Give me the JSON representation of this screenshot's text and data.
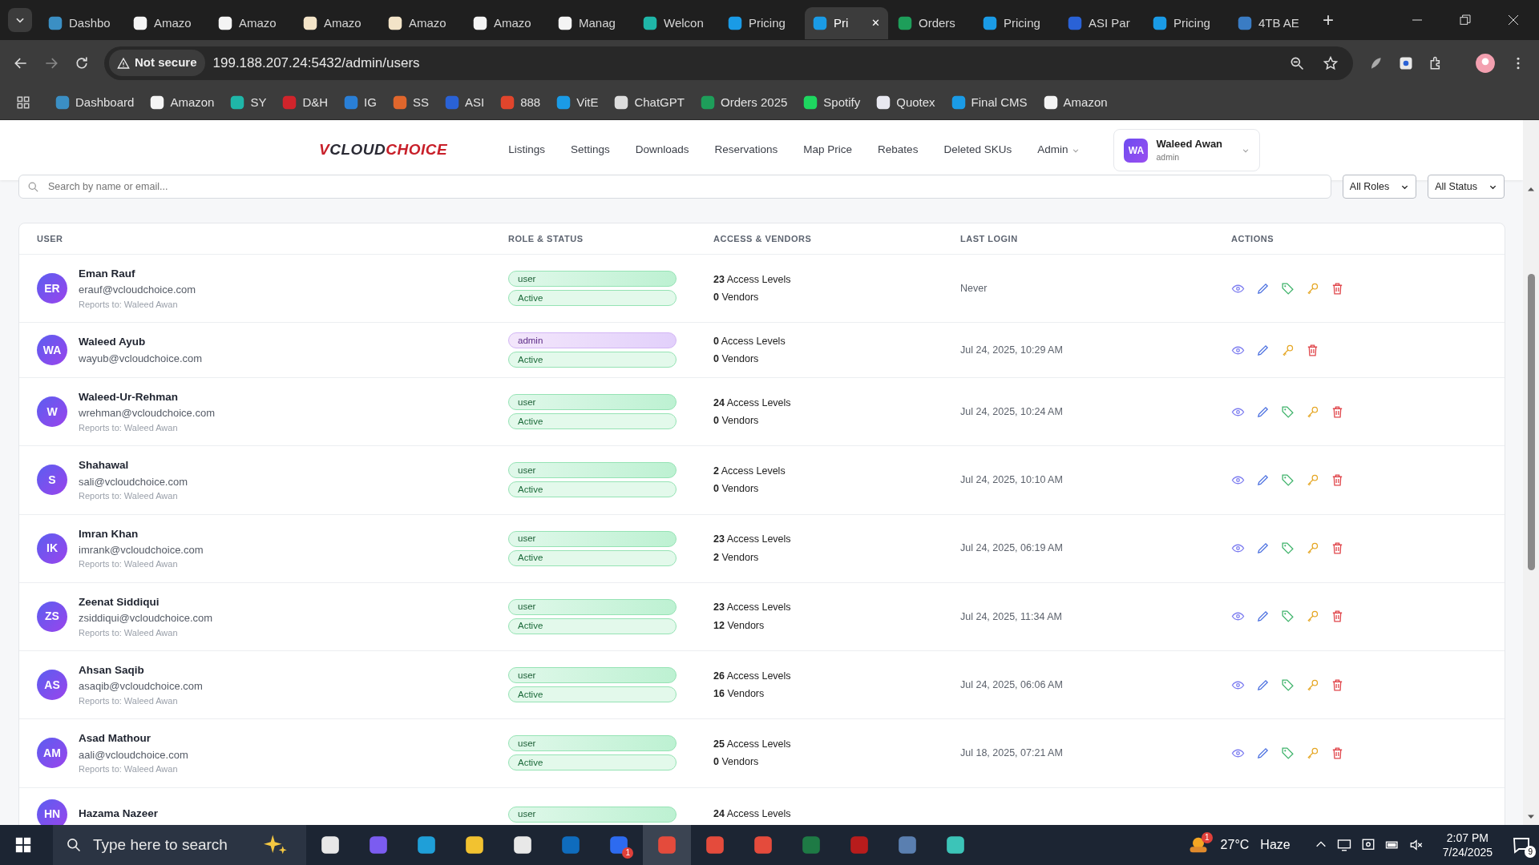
{
  "browser": {
    "tabs": [
      {
        "title": "Dashbo",
        "color": "#3b8fc4",
        "selected": false
      },
      {
        "title": "Amazo",
        "color": "#f4f4f4",
        "selected": false
      },
      {
        "title": "Amazo",
        "color": "#f4f4f4",
        "selected": false
      },
      {
        "title": "Amazo",
        "color": "#f3e4c8",
        "selected": false
      },
      {
        "title": "Amazo",
        "color": "#f3e4c8",
        "selected": false
      },
      {
        "title": "Amazo",
        "color": "#f4f4f4",
        "selected": false
      },
      {
        "title": "Manag",
        "color": "#f4f4f4",
        "selected": false
      },
      {
        "title": "Welcon",
        "color": "#1fb6a8",
        "selected": false
      },
      {
        "title": "Pricing",
        "color": "#1a9be6",
        "selected": false
      },
      {
        "title": "Pri",
        "color": "#1a9be6",
        "selected": true
      },
      {
        "title": "Orders",
        "color": "#1e9e5a",
        "selected": false
      },
      {
        "title": "Pricing",
        "color": "#1a9be6",
        "selected": false
      },
      {
        "title": "ASI Par",
        "color": "#2a62d6",
        "selected": false
      },
      {
        "title": "Pricing",
        "color": "#1a9be6",
        "selected": false
      },
      {
        "title": "4TB AE",
        "color": "#3a7cc4",
        "selected": false
      }
    ],
    "close_glyph": "✕",
    "new_tab_glyph": "+",
    "security_label": "Not secure",
    "url": "199.188.207.24:5432/admin/users",
    "bookmarks": [
      {
        "label": "Dashboard",
        "color": "#3b8fc4"
      },
      {
        "label": "Amazon",
        "color": "#f4f4f4"
      },
      {
        "label": "SY",
        "color": "#1fb6a8"
      },
      {
        "label": "D&H",
        "color": "#d0242b"
      },
      {
        "label": "IG",
        "color": "#2a7fd6"
      },
      {
        "label": "SS",
        "color": "#e0662c"
      },
      {
        "label": "ASI",
        "color": "#2a62d6"
      },
      {
        "label": "888",
        "color": "#e0452c"
      },
      {
        "label": "VitE",
        "color": "#1a9be6"
      },
      {
        "label": "ChatGPT",
        "color": "#dddddd"
      },
      {
        "label": "Orders 2025",
        "color": "#1e9e5a"
      },
      {
        "label": "Spotify",
        "color": "#1ed760"
      },
      {
        "label": "Quotex",
        "color": "#e8e8f0"
      },
      {
        "label": "Final CMS",
        "color": "#1a9be6"
      },
      {
        "label": "Amazon",
        "color": "#f4f4f4"
      }
    ]
  },
  "app": {
    "logo": [
      {
        "text": "V",
        "color": "#c8202a"
      },
      {
        "text": "CLOUD",
        "color": "#2b2b35"
      },
      {
        "text": "CHOICE",
        "color": "#c8202a"
      }
    ],
    "nav": [
      {
        "label": "Listings",
        "dropdown": false
      },
      {
        "label": "Settings",
        "dropdown": false
      },
      {
        "label": "Downloads",
        "dropdown": false
      },
      {
        "label": "Reservations",
        "dropdown": false
      },
      {
        "label": "Map Price",
        "dropdown": false
      },
      {
        "label": "Rebates",
        "dropdown": false
      },
      {
        "label": "Deleted SKUs",
        "dropdown": false
      },
      {
        "label": "Admin",
        "dropdown": true
      }
    ],
    "user": {
      "initials": "WA",
      "name": "Waleed Awan",
      "role": "admin"
    },
    "search": {
      "placeholder": "Search by name or email..."
    },
    "filters": [
      "All Roles",
      "All Status"
    ],
    "table": {
      "columns": [
        "USER",
        "ROLE & STATUS",
        "ACCESS & VENDORS",
        "LAST LOGIN",
        "ACTIONS"
      ],
      "rows": [
        {
          "initials": "ER",
          "name": "Eman Rauf",
          "email": "erauf@vcloudchoice.com",
          "reports_to": "Reports to: Waleed Awan",
          "role": {
            "label": "user",
            "kind": "user"
          },
          "status": "Active",
          "access": "**23** Access Levels",
          "vendors": "**0** Vendors",
          "last_login": "Never",
          "actions": [
            {
              "kind": "view"
            },
            {
              "kind": "edit"
            },
            {
              "kind": "tag"
            },
            {
              "kind": "key"
            },
            {
              "kind": "delete"
            }
          ]
        },
        {
          "initials": "WA",
          "name": "Waleed Ayub",
          "email": "wayub@vcloudchoice.com",
          "role": {
            "label": "admin",
            "kind": "admin"
          },
          "status": "Active",
          "access": "**0** Access Levels",
          "vendors": "**0** Vendors",
          "last_login": "Jul 24, 2025, 10:29 AM",
          "actions": [
            {
              "kind": "view"
            },
            {
              "kind": "edit"
            },
            {
              "kind": "key"
            },
            {
              "kind": "delete"
            }
          ]
        },
        {
          "initials": "W",
          "name": "Waleed-Ur-Rehman",
          "email": "wrehman@vcloudchoice.com",
          "reports_to": "Reports to: Waleed Awan",
          "role": {
            "label": "user",
            "kind": "user"
          },
          "status": "Active",
          "access": "**24** Access Levels",
          "vendors": "**0** Vendors",
          "last_login": "Jul 24, 2025, 10:24 AM",
          "actions": [
            {
              "kind": "view"
            },
            {
              "kind": "edit"
            },
            {
              "kind": "tag"
            },
            {
              "kind": "key"
            },
            {
              "kind": "delete"
            }
          ]
        },
        {
          "initials": "S",
          "name": "Shahawal",
          "email": "sali@vcloudchoice.com",
          "reports_to": "Reports to: Waleed Awan",
          "role": {
            "label": "user",
            "kind": "user"
          },
          "status": "Active",
          "access": "**2** Access Levels",
          "vendors": "**0** Vendors",
          "last_login": "Jul 24, 2025, 10:10 AM",
          "actions": [
            {
              "kind": "view"
            },
            {
              "kind": "edit"
            },
            {
              "kind": "tag"
            },
            {
              "kind": "key"
            },
            {
              "kind": "delete"
            }
          ]
        },
        {
          "initials": "IK",
          "name": "Imran Khan",
          "email": "imrank@vcloudchoice.com",
          "reports_to": "Reports to: Waleed Awan",
          "role": {
            "label": "user",
            "kind": "user"
          },
          "status": "Active",
          "access": "**23** Access Levels",
          "vendors": "**2** Vendors",
          "last_login": "Jul 24, 2025, 06:19 AM",
          "actions": [
            {
              "kind": "view"
            },
            {
              "kind": "edit"
            },
            {
              "kind": "tag"
            },
            {
              "kind": "key"
            },
            {
              "kind": "delete"
            }
          ]
        },
        {
          "initials": "ZS",
          "name": "Zeenat Siddiqui",
          "email": "zsiddiqui@vcloudchoice.com",
          "reports_to": "Reports to: Waleed Awan",
          "role": {
            "label": "user",
            "kind": "user"
          },
          "status": "Active",
          "access": "**23** Access Levels",
          "vendors": "**12** Vendors",
          "last_login": "Jul 24, 2025, 11:34 AM",
          "actions": [
            {
              "kind": "view"
            },
            {
              "kind": "edit"
            },
            {
              "kind": "tag"
            },
            {
              "kind": "key"
            },
            {
              "kind": "delete"
            }
          ]
        },
        {
          "initials": "AS",
          "name": "Ahsan Saqib",
          "email": "asaqib@vcloudchoice.com",
          "reports_to": "Reports to: Waleed Awan",
          "role": {
            "label": "user",
            "kind": "user"
          },
          "status": "Active",
          "access": "**26** Access Levels",
          "vendors": "**16** Vendors",
          "last_login": "Jul 24, 2025, 06:06 AM",
          "actions": [
            {
              "kind": "view"
            },
            {
              "kind": "edit"
            },
            {
              "kind": "tag"
            },
            {
              "kind": "key"
            },
            {
              "kind": "delete"
            }
          ]
        },
        {
          "initials": "AM",
          "name": "Asad Mathour",
          "email": "aali@vcloudchoice.com",
          "reports_to": "Reports to: Waleed Awan",
          "role": {
            "label": "user",
            "kind": "user"
          },
          "status": "Active",
          "access": "**25** Access Levels",
          "vendors": "**0** Vendors",
          "last_login": "Jul 18, 2025, 07:21 AM",
          "actions": [
            {
              "kind": "view"
            },
            {
              "kind": "edit"
            },
            {
              "kind": "tag"
            },
            {
              "kind": "key"
            },
            {
              "kind": "delete"
            }
          ]
        },
        {
          "initials": "HN",
          "name": "Hazama Nazeer",
          "role": {
            "label": "user",
            "kind": "user"
          },
          "access": "**24** Access Levels"
        }
      ]
    }
  },
  "taskbar": {
    "search_placeholder": "Type here to search",
    "apps": [
      {
        "color": "#e8e8e8",
        "selected": false
      },
      {
        "color": "#7b5cf0",
        "selected": false
      },
      {
        "color": "#1f9fd8",
        "selected": false
      },
      {
        "color": "#f2c230",
        "selected": false
      },
      {
        "color": "#e8e8e8",
        "selected": false
      },
      {
        "color": "#0f6cbd",
        "selected": false
      },
      {
        "color": "#2d6bf0",
        "selected": false,
        "badge": "1"
      },
      {
        "color": "#e44b3c",
        "selected": true
      },
      {
        "color": "#e44b3c",
        "selected": false
      },
      {
        "color": "#e44b3c",
        "selected": false
      },
      {
        "color": "#1e7a45",
        "selected": false
      },
      {
        "color": "#b81c1c",
        "selected": false
      },
      {
        "color": "#5a7fb0",
        "selected": false
      },
      {
        "color": "#3cc4b8",
        "selected": false
      }
    ],
    "weather_badge": "1",
    "temperature": "27°C",
    "condition": "Haze",
    "time": "2:07 PM",
    "date": "7/24/2025",
    "notifications": "9"
  }
}
